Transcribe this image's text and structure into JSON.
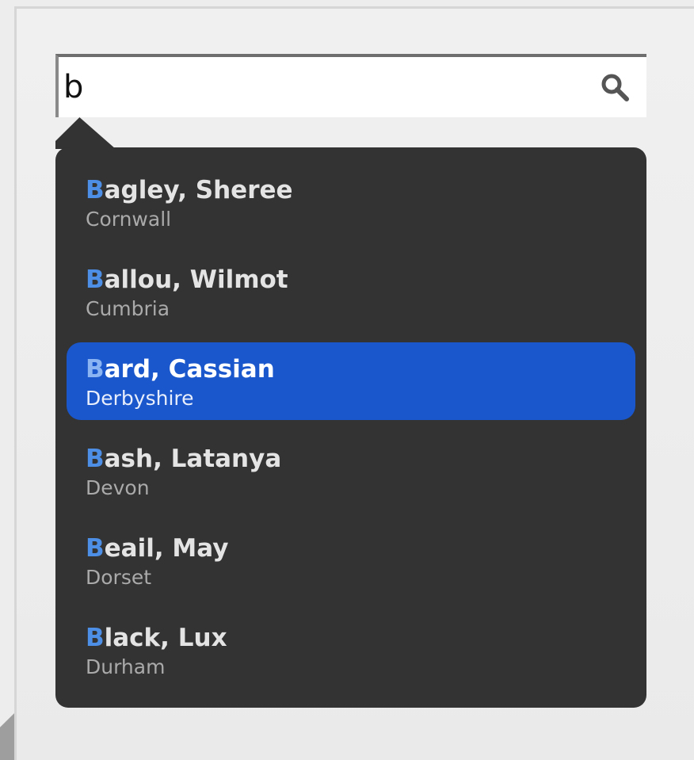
{
  "search": {
    "value": "b",
    "placeholder": ""
  },
  "icons": {
    "search": "search-icon"
  },
  "colors": {
    "dropdown_bg": "#333333",
    "selected_bg": "#1a57cc",
    "match_highlight": "#4d8ee6"
  },
  "results": [
    {
      "match": "B",
      "rest": "agley, Sheree",
      "county": "Cornwall",
      "selected": false
    },
    {
      "match": "B",
      "rest": "allou, Wilmot",
      "county": "Cumbria",
      "selected": false
    },
    {
      "match": "B",
      "rest": "ard, Cassian",
      "county": "Derbyshire",
      "selected": true
    },
    {
      "match": "B",
      "rest": "ash, Latanya",
      "county": "Devon",
      "selected": false
    },
    {
      "match": "B",
      "rest": "eail, May",
      "county": "Dorset",
      "selected": false
    },
    {
      "match": "B",
      "rest": "lack, Lux",
      "county": "Durham",
      "selected": false
    }
  ]
}
